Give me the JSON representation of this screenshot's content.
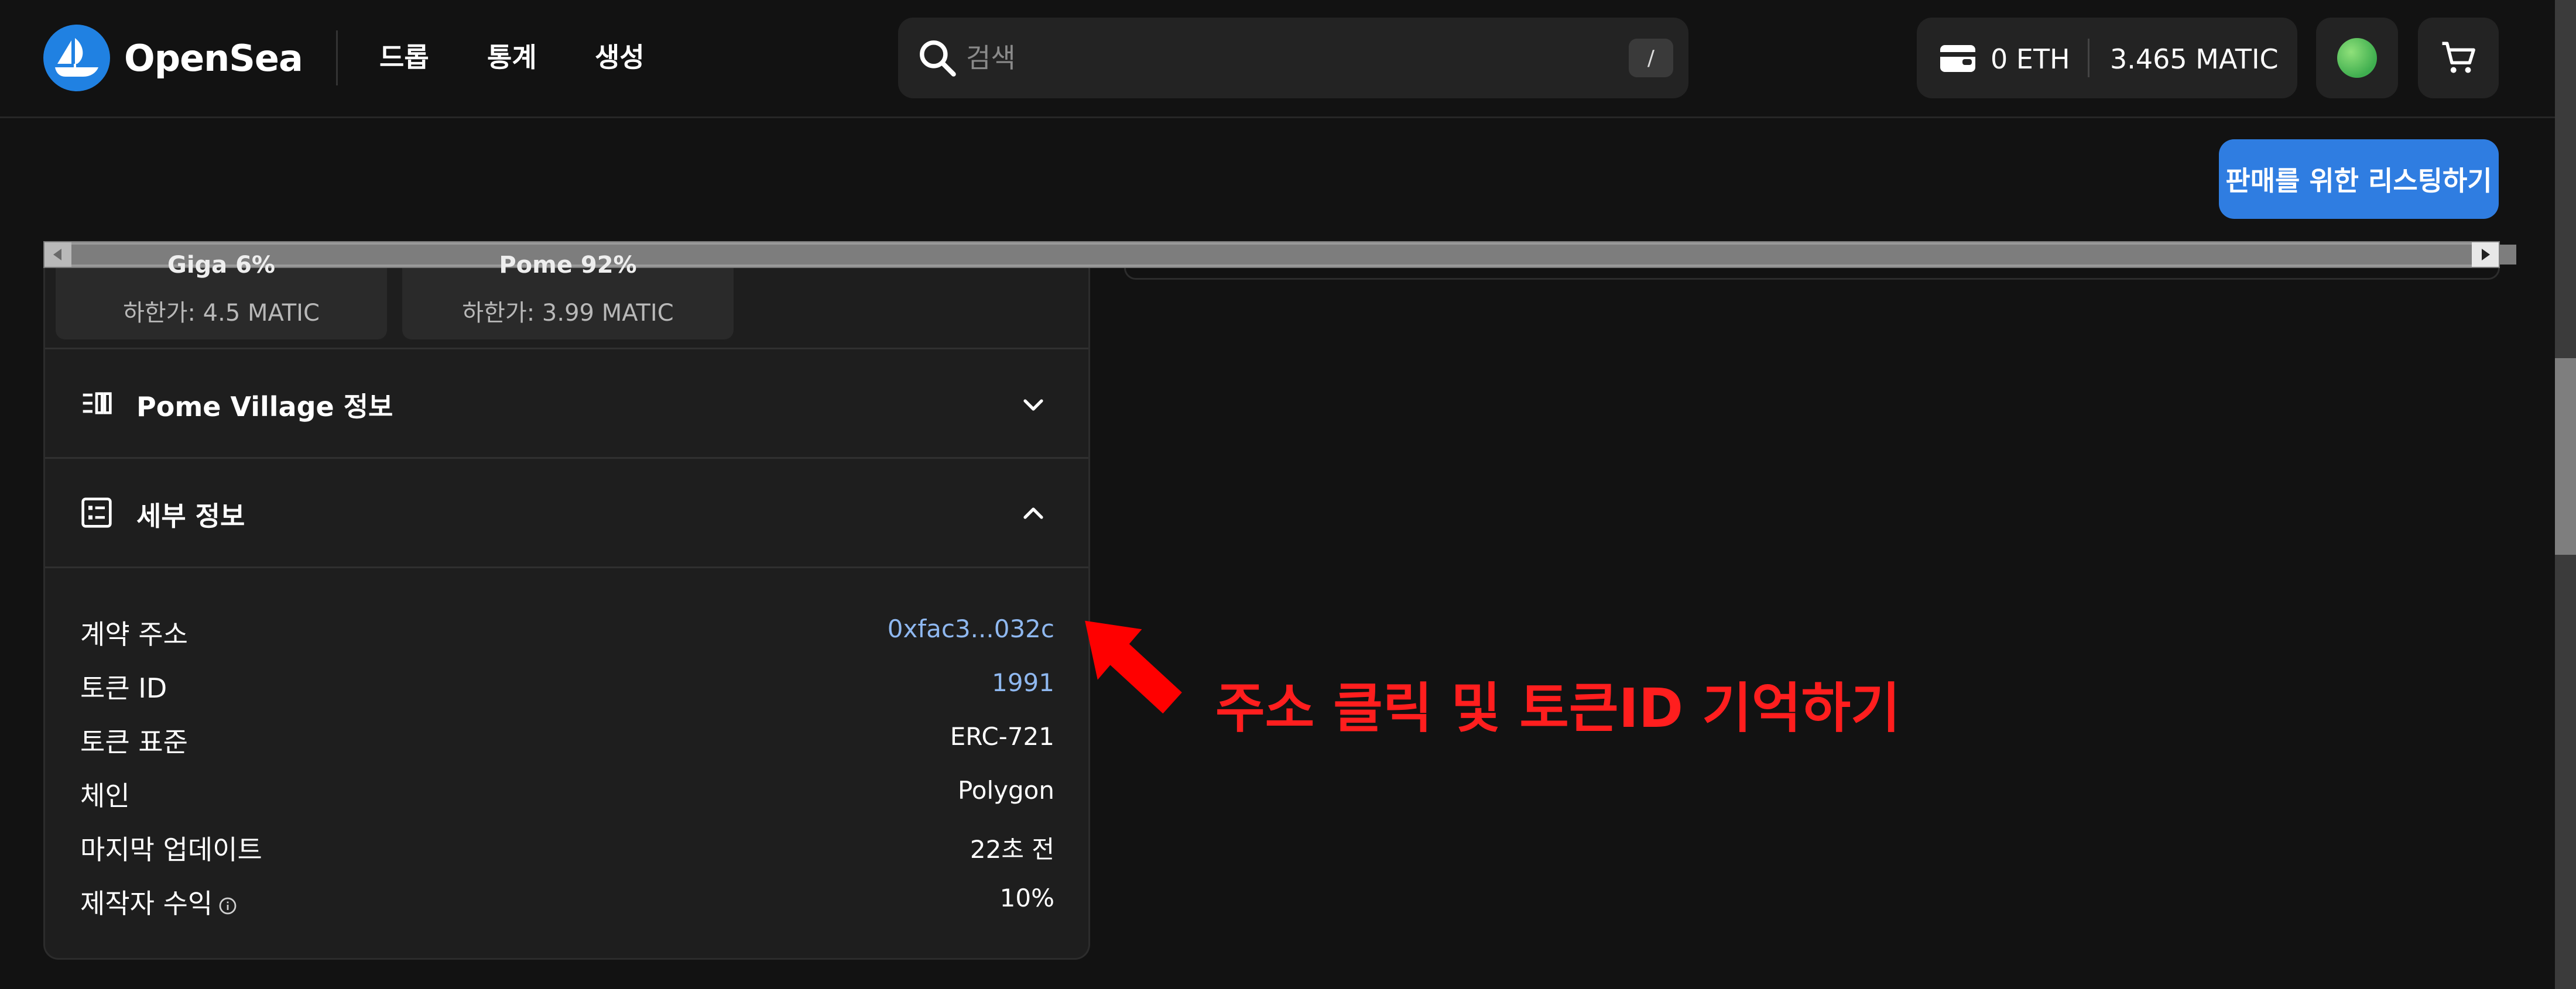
{
  "header": {
    "brand": "OpenSea",
    "nav": [
      {
        "label": "드롭"
      },
      {
        "label": "통계"
      },
      {
        "label": "생성"
      }
    ],
    "search_placeholder": "검색",
    "search_shortcut": "/",
    "wallet_eth": "0 ETH",
    "wallet_matic": "3.465 MATIC"
  },
  "actions": {
    "list_for_sale": "판매를 위한 리스팅하기"
  },
  "traits": [
    {
      "name_cutoff": "Giga 6%",
      "floor": "하한가: 4.5 MATIC"
    },
    {
      "name_cutoff": "Pome 92%",
      "floor": "하한가: 3.99 MATIC"
    }
  ],
  "sections": {
    "about": "Pome Village 정보",
    "details": "세부 정보"
  },
  "details": [
    {
      "label": "계약 주소",
      "value": "0xfac3...032c",
      "link": true
    },
    {
      "label": "토큰 ID",
      "value": "1991",
      "link": true
    },
    {
      "label": "토큰 표준",
      "value": "ERC-721",
      "link": false
    },
    {
      "label": "체인",
      "value": "Polygon",
      "link": false
    },
    {
      "label": "마지막 업데이트",
      "value": "22초 전",
      "link": false
    },
    {
      "label": "제작자 수익",
      "value": "10%",
      "link": false
    }
  ],
  "annotation": {
    "text": "주소 클릭 및 토큰ID 기억하기",
    "color": "#ff1e1e"
  },
  "colors": {
    "accent": "#2f7de1",
    "link": "#8fb8f0",
    "background": "#121212",
    "panel": "#1e1e1e"
  },
  "icons": [
    "opensea-logo-icon",
    "search-icon",
    "wallet-icon",
    "avatar",
    "cart-icon",
    "collection-info-icon",
    "details-list-icon",
    "chevron-down-icon",
    "chevron-up-icon",
    "info-icon",
    "red-arrow-icon"
  ]
}
